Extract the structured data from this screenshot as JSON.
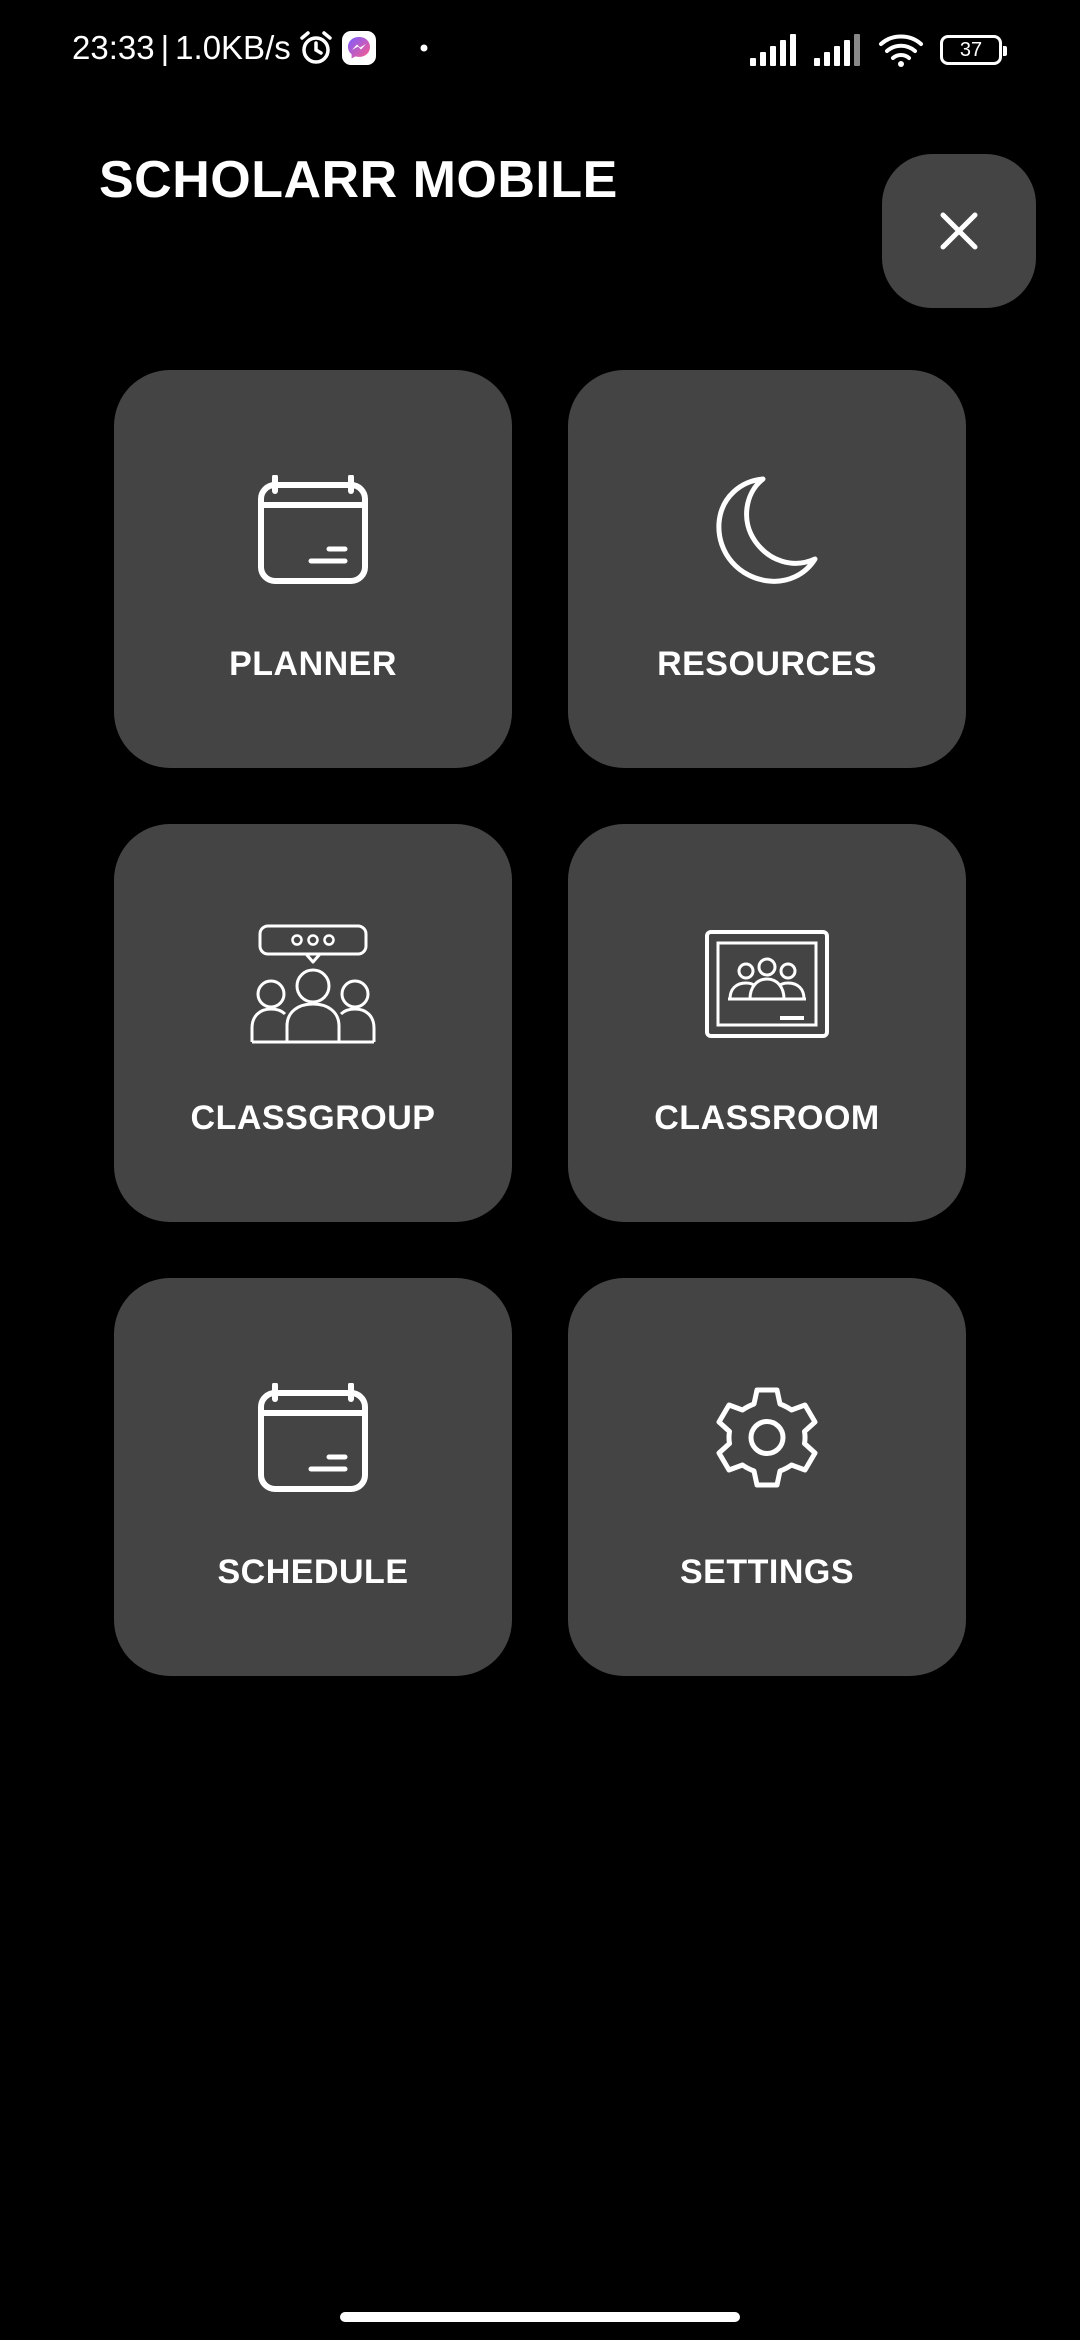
{
  "status_bar": {
    "time": "23:33",
    "separator": "|",
    "network_speed": "1.0KB/s",
    "battery_level": "37",
    "icons": [
      "alarm-icon",
      "messenger-icon",
      "notification-dot-icon",
      "signal-icon",
      "signal-icon",
      "wifi-icon",
      "battery-icon"
    ]
  },
  "header": {
    "title": "SCHOLARR MOBILE",
    "close_icon": "close-icon"
  },
  "menu": {
    "tiles": [
      {
        "label": "PLANNER",
        "icon": "calendar-icon"
      },
      {
        "label": "RESOURCES",
        "icon": "moon-icon"
      },
      {
        "label": "CLASSGROUP",
        "icon": "group-chat-icon"
      },
      {
        "label": "CLASSROOM",
        "icon": "classroom-board-icon"
      },
      {
        "label": "SCHEDULE",
        "icon": "calendar-icon"
      },
      {
        "label": "SETTINGS",
        "icon": "gear-icon"
      }
    ]
  },
  "colors": {
    "background": "#000000",
    "tile": "#444444",
    "text": "#ffffff",
    "messenger_gradient_start": "#7b5cff",
    "messenger_gradient_end": "#ff5c8a"
  }
}
